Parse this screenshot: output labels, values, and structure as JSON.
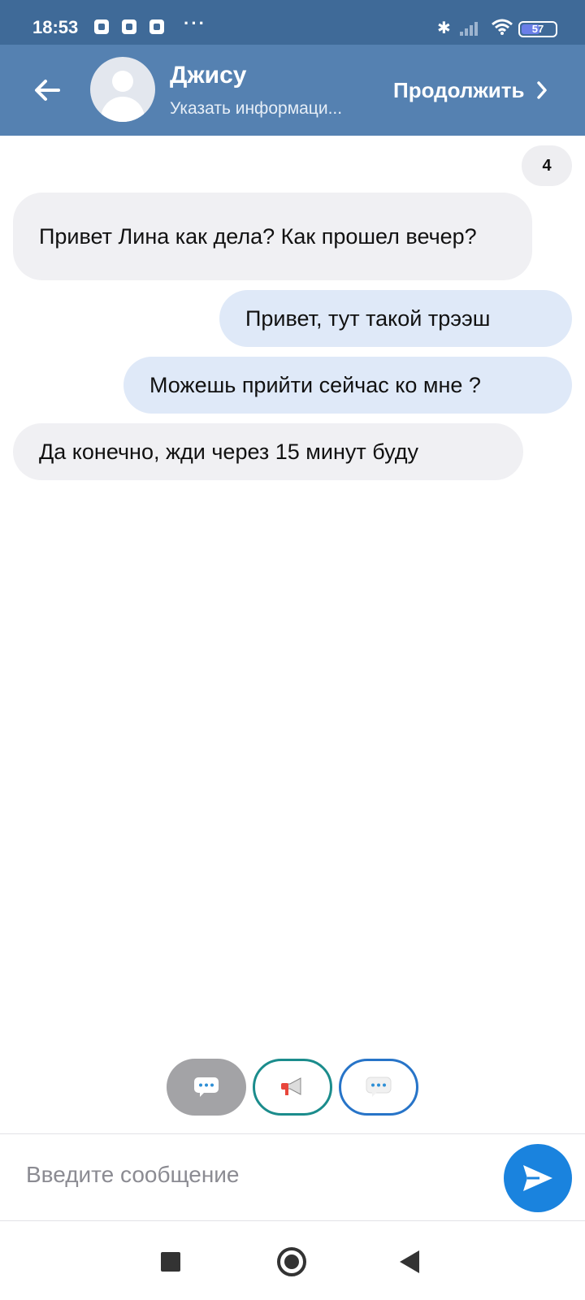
{
  "status_bar": {
    "time": "18:53",
    "more": "···",
    "battery": "57",
    "icons": [
      "notification-icon",
      "notification-icon",
      "telegram-icon",
      "bluetooth-icon",
      "signal-icon",
      "wifi-icon",
      "battery-icon"
    ]
  },
  "header": {
    "contact_name": "Джису",
    "subtitle": "Указать информаци...",
    "continue_label": "Продолжить",
    "back_icon": "arrow-left-icon",
    "colors": {
      "status_bar": "#3f6a98",
      "header": "#5581b1"
    }
  },
  "messages": {
    "count_badge": "4",
    "items": [
      {
        "side": "incoming",
        "text": "Привет Лина как дела? Как прошел вечер?"
      },
      {
        "side": "outgoing",
        "text": "Привет, тут такой трээш"
      },
      {
        "side": "outgoing",
        "text": "Можешь прийти сейчас ко мне ?"
      },
      {
        "side": "incoming",
        "text": "Да конечно, жди через 15 минут буду"
      }
    ],
    "colors": {
      "incoming": "#f0f0f3",
      "outgoing": "#dfe9f8"
    }
  },
  "quick_actions": [
    {
      "icon": "speech-bubble-icon",
      "style": "filled-gray"
    },
    {
      "icon": "megaphone-icon",
      "style": "teal-outline"
    },
    {
      "icon": "speech-bubble-icon",
      "style": "blue-outline"
    }
  ],
  "composer": {
    "placeholder": "Введите сообщение",
    "send_icon": "send-icon",
    "send_color": "#1a83de"
  }
}
